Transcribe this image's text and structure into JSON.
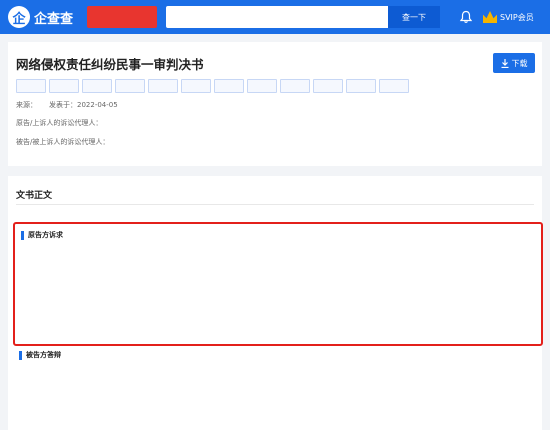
{
  "header": {
    "logo_glyph": "企",
    "logo_text": "企查查",
    "badge_lines": [
      "",
      ""
    ],
    "search_placeholder": "",
    "search_button": "查一下",
    "vip_label": "SVIP会员"
  },
  "doc": {
    "title": "网络侵权责任纠纷民事一审判决书",
    "download_label": "下载",
    "tags": [
      "",
      "",
      "",
      "",
      "",
      "",
      "",
      "",
      "",
      "",
      "",
      ""
    ],
    "source_label": "来源：",
    "source_value": "",
    "publish_label": "发表于：",
    "publish_date": "2022-04-05",
    "plaintiff_label": "原告/上诉人的诉讼代理人：",
    "plaintiff_value": "",
    "defendant_label": "被告/被上诉人的诉讼代理人：",
    "defendant_value": ""
  },
  "body": {
    "section_title": "文书正文",
    "doc_type": "",
    "claims_heading": "原告方诉求",
    "claims_lines": [
      "",
      "",
      "",
      "",
      "",
      "",
      "",
      "",
      ""
    ],
    "defense_heading": "被告方答辩",
    "defense_lines": [
      "",
      "",
      ""
    ]
  },
  "colors": {
    "brand_blue": "#1b6ee6",
    "highlight_red": "#e3201b",
    "badge_red": "#e8352f"
  }
}
